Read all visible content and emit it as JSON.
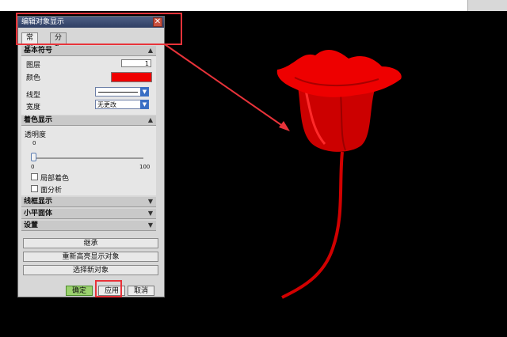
{
  "dialog": {
    "title": "编辑对象显示",
    "close_glyph": "✕",
    "tabs": [
      "常规",
      "分析"
    ],
    "sections": {
      "basic": {
        "title": "基本符号",
        "layer_label": "图层",
        "layer_value": "1",
        "color_label": "颜色",
        "color_value": "#ee0000",
        "linetype_label": "线型",
        "width_label": "宽度",
        "width_value": "无更改"
      },
      "shading": {
        "title": "着色显示",
        "transparency_label": "透明度",
        "slider_value_label": "0",
        "slider_min": "0",
        "slider_max": "100",
        "transparency_value": 0,
        "partial_shading_label": "局部着色",
        "face_analysis_label": "面分析"
      },
      "wireframe": {
        "title": "线框显示"
      },
      "facet": {
        "title": "小平面体"
      },
      "settings": {
        "title": "设置"
      }
    },
    "buttons": {
      "inherit": "继承",
      "rehighlight": "重新高亮显示对象",
      "select_new": "选择新对象",
      "ok": "确定",
      "apply": "应用",
      "cancel": "取消"
    }
  },
  "viewport": {
    "background": "#000000",
    "object_color": "#ee0000"
  },
  "annotation_color": "#e8333a"
}
